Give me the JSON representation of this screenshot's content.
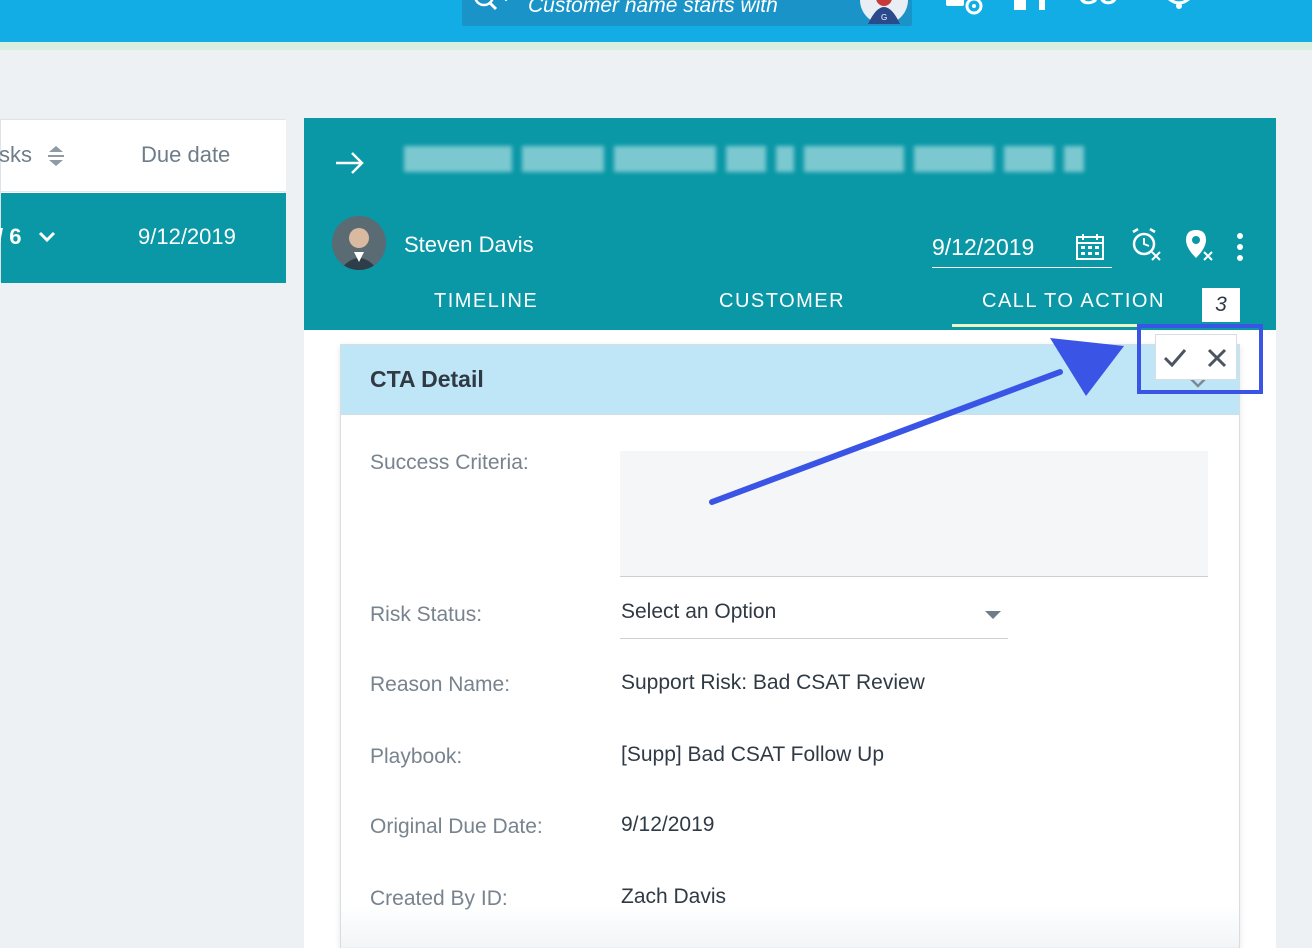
{
  "topbar": {
    "search_placeholder": "Customer name starts with",
    "icons": [
      "search-icon",
      "user-avatar",
      "settings-lock-icon",
      "people-icon",
      "go-label-icon",
      "bell-icon",
      "close-icon"
    ],
    "go_label": "GO",
    "color": "#12ade4"
  },
  "left_list": {
    "columns": [
      {
        "label": "sks"
      },
      {
        "label": "Due date"
      }
    ],
    "selected_row": {
      "tasks": "/ 6",
      "due_date": "9/12/2019"
    },
    "accent_color": "#0a97a6"
  },
  "detail": {
    "owner_name": "Steven Davis",
    "due_date": "9/12/2019",
    "tabs": [
      {
        "label": "TIMELINE"
      },
      {
        "label": "CUSTOMER"
      },
      {
        "label": "CALL TO ACTION",
        "count": "3",
        "active": true
      }
    ],
    "header_color": "#0a97a6"
  },
  "cta_card": {
    "title": "CTA Detail",
    "fields": [
      {
        "label": "Success Criteria:",
        "value": ""
      },
      {
        "label": "Risk Status:",
        "value": "Select an Option"
      },
      {
        "label": "Reason Name:",
        "value": "Support Risk: Bad CSAT Review"
      },
      {
        "label": "Playbook:",
        "value": "[Supp] Bad CSAT Follow Up"
      },
      {
        "label": "Original Due Date:",
        "value": "9/12/2019"
      },
      {
        "label": "Created By ID:",
        "value": "Zach Davis"
      }
    ],
    "header_color": "#bfe6f7"
  },
  "annotation": {
    "color": "#3a54e6"
  }
}
